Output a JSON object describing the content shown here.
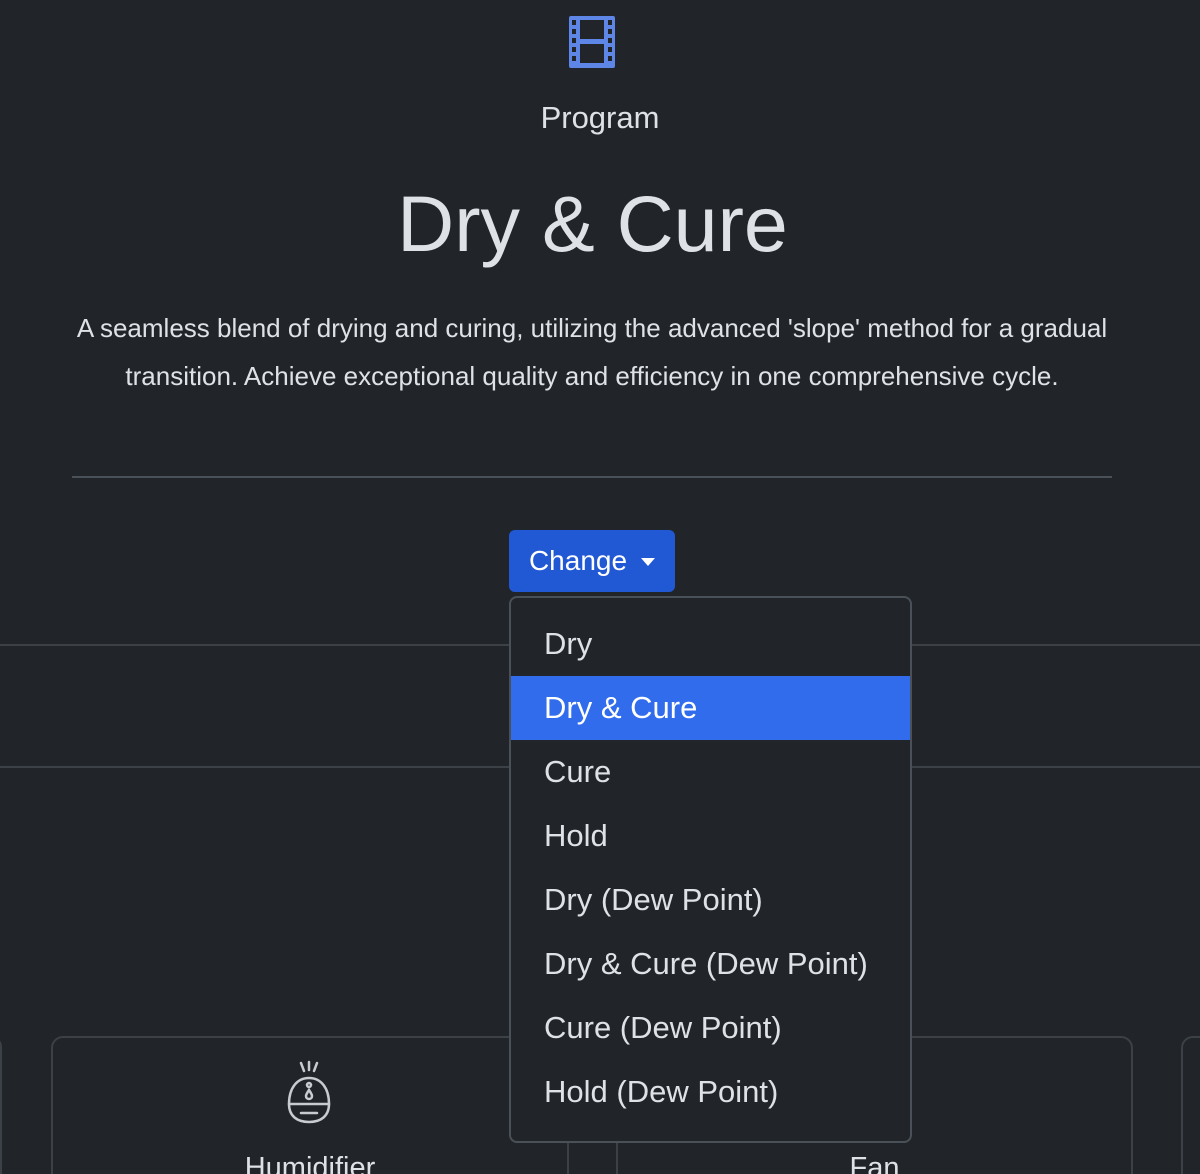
{
  "program": {
    "icon": "film-icon",
    "label": "Program",
    "title": "Dry & Cure",
    "description": "A seamless blend of drying and curing, utilizing the advanced 'slope' method for a gradual transition. Achieve exceptional quality and efficiency in one comprehensive cycle."
  },
  "change_button": {
    "label": "Change",
    "color": "#2158d4"
  },
  "dropdown": {
    "selected": "Dry & Cure",
    "active_color": "#316ced",
    "items": [
      {
        "label": "Dry"
      },
      {
        "label": "Dry & Cure"
      },
      {
        "label": "Cure"
      },
      {
        "label": "Hold"
      },
      {
        "label": "Dry (Dew Point)"
      },
      {
        "label": "Dry & Cure (Dew Point)"
      },
      {
        "label": "Cure (Dew Point)"
      },
      {
        "label": "Hold (Dew Point)"
      }
    ]
  },
  "devices": [
    {
      "label": "Humidifier",
      "icon": "humidifier-icon"
    },
    {
      "label": "Fan",
      "icon": "fan-icon"
    }
  ],
  "colors": {
    "background": "#212529",
    "accent": "#316ced"
  }
}
